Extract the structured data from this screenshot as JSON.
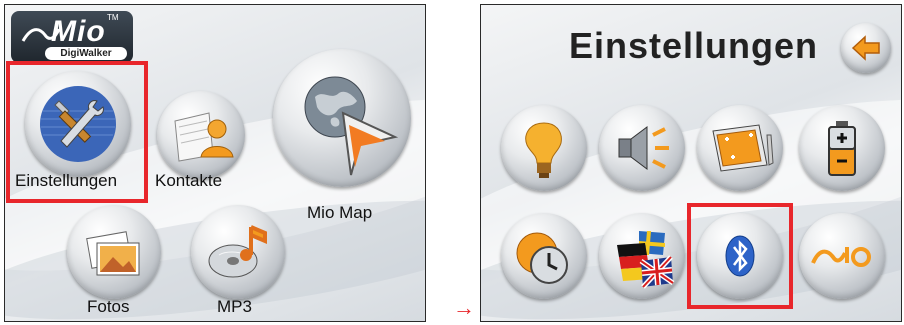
{
  "main_screen": {
    "logo": {
      "brand": "Mio",
      "sub": "DigiWalker",
      "tm": "TM"
    },
    "apps": [
      {
        "label": "Einstellungen",
        "icon": "tools-icon"
      },
      {
        "label": "Kontakte",
        "icon": "contacts-icon"
      },
      {
        "label": "Mio Map",
        "icon": "globe-map-icon"
      },
      {
        "label": "Fotos",
        "icon": "photos-icon"
      },
      {
        "label": "MP3",
        "icon": "mp3-disc-icon"
      }
    ],
    "highlighted": "Einstellungen"
  },
  "transition_arrow": "→",
  "settings_screen": {
    "title": "Einstellungen",
    "back_icon": "back-arrow-icon",
    "items": [
      {
        "icon": "backlight-bulb-icon"
      },
      {
        "icon": "volume-speaker-icon"
      },
      {
        "icon": "screen-calibration-icon"
      },
      {
        "icon": "battery-icon"
      },
      {
        "icon": "clock-globe-icon"
      },
      {
        "icon": "language-flags-icon"
      },
      {
        "icon": "bluetooth-icon"
      },
      {
        "icon": "mio-about-icon"
      }
    ],
    "highlighted": "bluetooth-icon"
  },
  "colors": {
    "highlight": "#e8262b",
    "accent_orange": "#f39a1e"
  }
}
